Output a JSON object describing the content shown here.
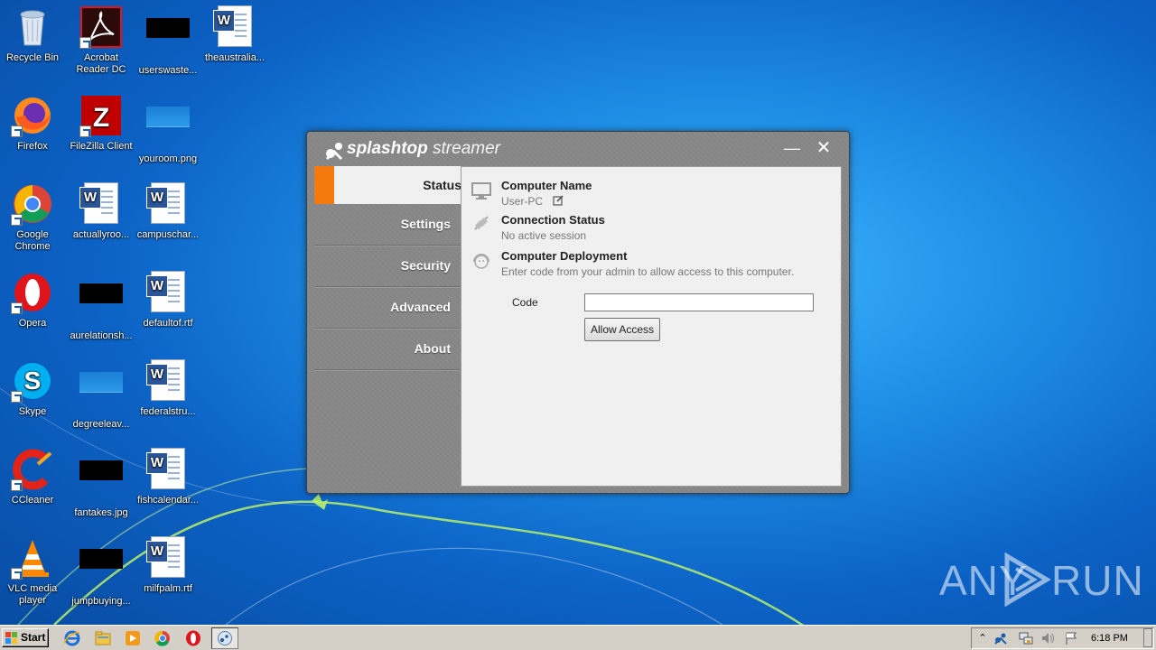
{
  "desktop": {
    "icons": [
      {
        "label": "Recycle Bin"
      },
      {
        "label": "Acrobat Reader DC"
      },
      {
        "label": "userswaste..."
      },
      {
        "label": "theaustralia..."
      },
      {
        "label": "Firefox"
      },
      {
        "label": "FileZilla Client"
      },
      {
        "label": "youroom.png"
      },
      {
        "label": "Google Chrome"
      },
      {
        "label": "actuallyroo..."
      },
      {
        "label": "campuschar..."
      },
      {
        "label": "Opera"
      },
      {
        "label": "aurelationsh..."
      },
      {
        "label": "defaultof.rtf"
      },
      {
        "label": "Skype"
      },
      {
        "label": "degreeleav..."
      },
      {
        "label": "federalstru..."
      },
      {
        "label": "CCleaner"
      },
      {
        "label": "fantakes.jpg"
      },
      {
        "label": "fishcalendar..."
      },
      {
        "label": "VLC media player"
      },
      {
        "label": "jumpbuying..."
      },
      {
        "label": "milfpalm.rtf"
      }
    ]
  },
  "window": {
    "logo_main": "splashtop",
    "logo_sub": "streamer",
    "minimize_label": "—",
    "close_label": "✕",
    "nav": [
      "Status",
      "Settings",
      "Security",
      "Advanced",
      "About"
    ],
    "status": {
      "computer_name_title": "Computer Name",
      "computer_name_value": "User-PC",
      "connection_title": "Connection Status",
      "connection_value": "No active session",
      "deployment_title": "Computer Deployment",
      "deployment_value": "Enter code from your admin to allow access to this computer.",
      "code_label": "Code",
      "code_value": "",
      "allow_button": "Allow Access"
    }
  },
  "watermark": {
    "left": "ANY",
    "right": "RUN"
  },
  "taskbar": {
    "start_label": "Start",
    "clock": "6:18 PM"
  },
  "colors": {
    "accent": "#f47a10",
    "window_frame": "#8a8a8a",
    "panel_bg": "#f0f0f0",
    "desktop_blue": "#1f8fe6"
  }
}
